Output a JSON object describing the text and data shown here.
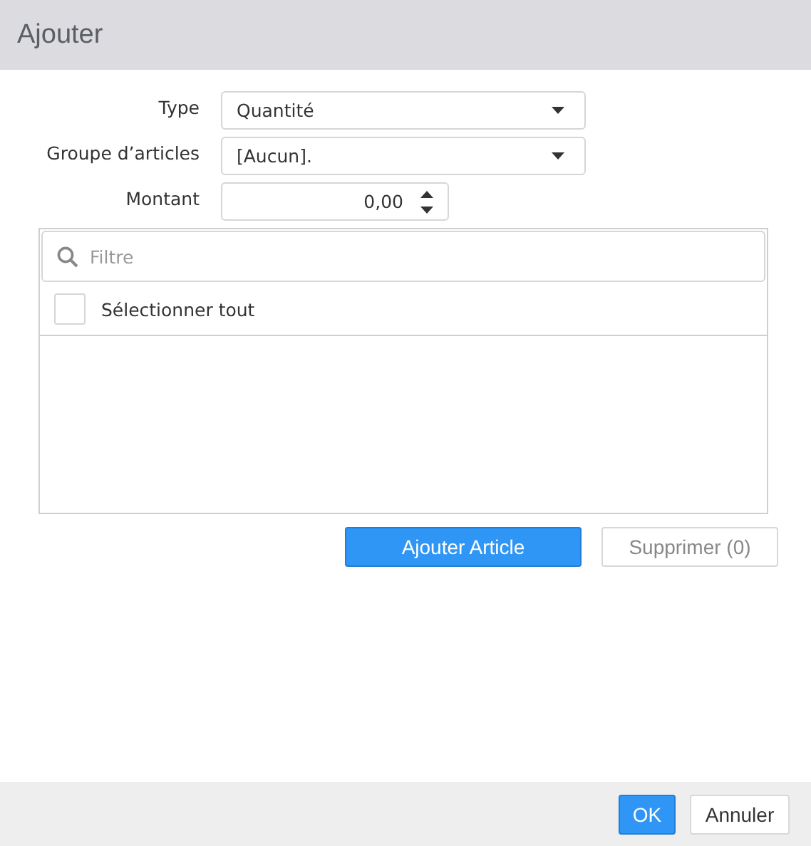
{
  "window": {
    "title": "Ajouter"
  },
  "fields": [
    {
      "kind": "select",
      "label": "Type",
      "value": "Quantité"
    },
    {
      "kind": "select",
      "label": "Groupe d’articles",
      "value": "[Aucun]."
    },
    {
      "kind": "number",
      "label": "Montant",
      "value": "0,00"
    }
  ],
  "list": {
    "filter": {
      "placeholder": "Filtre"
    },
    "select_all": {
      "label": "Sélectionner tout",
      "checked": false
    }
  },
  "actions": [
    {
      "label": "Ajouter Article",
      "primary": true,
      "disabled": false
    },
    {
      "label": "Supprimer (0)",
      "primary": false,
      "disabled": true
    }
  ],
  "footer": {
    "buttons": [
      {
        "label": "OK",
        "primary": true
      },
      {
        "label": "Annuler",
        "primary": false
      }
    ]
  }
}
